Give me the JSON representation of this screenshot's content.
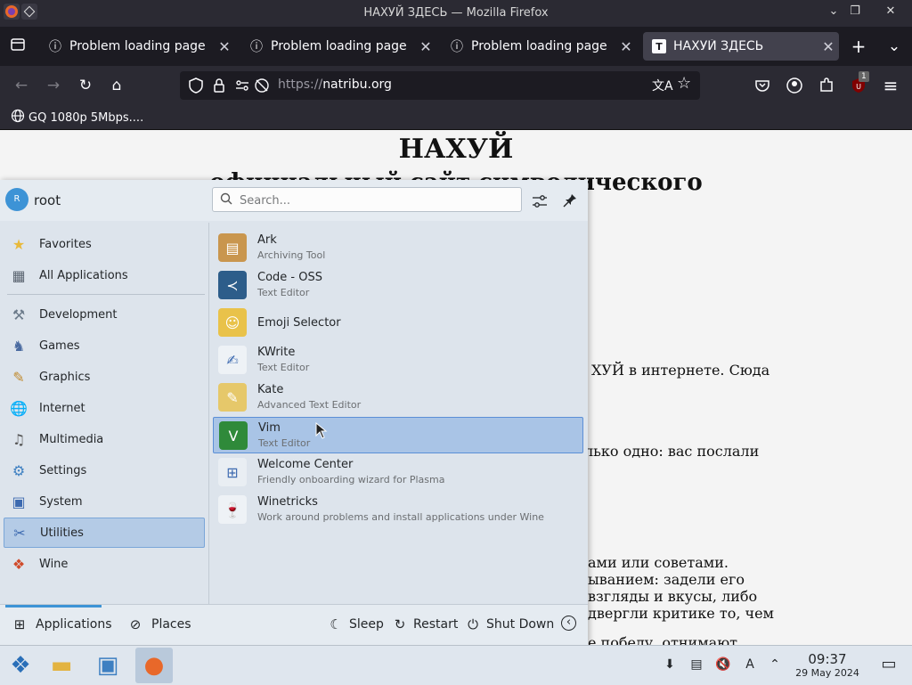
{
  "window": {
    "title": "НАХУЙ ЗДЕСЬ — Mozilla Firefox",
    "controls": {
      "minimize": "⌄",
      "maximize": "⌃",
      "restore": "❐",
      "close": "✕"
    }
  },
  "tabs": [
    {
      "label": "Problem loading page",
      "icon": "info-icon",
      "active": false,
      "close": "✕",
      "glyph": "ⓘ"
    },
    {
      "label": "Problem loading page",
      "icon": "info-icon",
      "active": false,
      "close": "✕",
      "glyph": "ⓘ"
    },
    {
      "label": "Problem loading page",
      "icon": "info-icon",
      "active": false,
      "close": "✕",
      "glyph": "ⓘ"
    },
    {
      "label": "НАХУЙ ЗДЕСЬ",
      "icon": "translate-icon",
      "active": true,
      "close": "✕",
      "glyph": "T"
    }
  ],
  "tabstrip": {
    "new_tab": "+",
    "list_all": "⌄"
  },
  "navbar": {
    "back": "←",
    "forward": "→",
    "reload": "↻",
    "home": "⌂",
    "url_scheme": "https://",
    "url_host": "natribu.org",
    "translate": "文A",
    "bookmark": "☆",
    "pocket": "◡",
    "account": "◉",
    "extensions": "⧉",
    "ublock": "U",
    "ublock_badge": "1",
    "menu": "≡"
  },
  "bookmarks": [
    {
      "label": "GQ 1080p 5Mbps....",
      "icon": "globe-icon"
    }
  ],
  "webpage": {
    "heading": "НАХУЙ",
    "subheading": "официальный сайт символического",
    "fragments": [
      "ХУЙ в интернете. Сюда",
      "лько одно: вас послали",
      "ами или советами.",
      "ыванием:  задели  его",
      "взгляды и вкусы, либо",
      "двергли критике то, чем",
      "е победу, отнимают"
    ]
  },
  "launcher": {
    "user": {
      "initial": "R",
      "name": "root"
    },
    "search_placeholder": "Search...",
    "header_buttons": {
      "configure": "⚙",
      "pin": "📌"
    },
    "categories": [
      {
        "label": "Favorites",
        "icon": "favorites-icon",
        "glyph": "★",
        "color": "#e8b93a",
        "selected": false
      },
      {
        "label": "All Applications",
        "icon": "all-applications-icon",
        "glyph": "▦",
        "color": "#5a6470",
        "selected": false
      },
      {
        "label": "Development",
        "icon": "development-icon",
        "glyph": "⚒",
        "color": "#6b7a8a",
        "selected": false
      },
      {
        "label": "Games",
        "icon": "games-icon",
        "glyph": "♞",
        "color": "#4a6aa0",
        "selected": false
      },
      {
        "label": "Graphics",
        "icon": "graphics-icon",
        "glyph": "✎",
        "color": "#c08a2e",
        "selected": false
      },
      {
        "label": "Internet",
        "icon": "internet-icon",
        "glyph": "🌐",
        "color": "#3d7fc1",
        "selected": false
      },
      {
        "label": "Multimedia",
        "icon": "multimedia-icon",
        "glyph": "♫",
        "color": "#555",
        "selected": false
      },
      {
        "label": "Settings",
        "icon": "settings-icon",
        "glyph": "⚙",
        "color": "#3d7fc1",
        "selected": false
      },
      {
        "label": "System",
        "icon": "system-icon",
        "glyph": "▣",
        "color": "#3d6ab0",
        "selected": false
      },
      {
        "label": "Utilities",
        "icon": "utilities-icon",
        "glyph": "✂",
        "color": "#3d6ab0",
        "selected": true
      },
      {
        "label": "Wine",
        "icon": "wine-icon",
        "glyph": "❖",
        "color": "#d04a2a",
        "selected": false
      }
    ],
    "apps": [
      {
        "name": "Ark",
        "desc": "Archiving Tool",
        "icon": "ark-icon",
        "glyph": "▤",
        "bg": "#c9964e",
        "selected": false
      },
      {
        "name": "Code - OSS",
        "desc": "Text Editor",
        "icon": "code-oss-icon",
        "glyph": "≺",
        "bg": "#2d5d8a",
        "selected": false
      },
      {
        "name": "Emoji Selector",
        "desc": "",
        "icon": "emoji-selector-icon",
        "glyph": "☺",
        "bg": "#e9c24a",
        "selected": false
      },
      {
        "name": "KWrite",
        "desc": "Text Editor",
        "icon": "kwrite-icon",
        "glyph": "✍",
        "bg": "#eef2f6",
        "selected": false
      },
      {
        "name": "Kate",
        "desc": "Advanced Text Editor",
        "icon": "kate-icon",
        "glyph": "✎",
        "bg": "#e6c86a",
        "selected": false
      },
      {
        "name": "Vim",
        "desc": "Text Editor",
        "icon": "vim-icon",
        "glyph": "V",
        "bg": "#2f8a3a",
        "selected": true
      },
      {
        "name": "Welcome Center",
        "desc": "Friendly onboarding wizard for Plasma",
        "icon": "welcome-center-icon",
        "glyph": "⊞",
        "bg": "#e9eef3",
        "selected": false
      },
      {
        "name": "Winetricks",
        "desc": "Work around problems and install applications under Wine",
        "icon": "winetricks-icon",
        "glyph": "🍷",
        "bg": "#eef2f6",
        "selected": false
      }
    ],
    "footer": {
      "tabs": [
        {
          "label": "Applications",
          "icon": "applications-grid-icon",
          "glyph": "⊞",
          "active": true
        },
        {
          "label": "Places",
          "icon": "places-compass-icon",
          "glyph": "⊘",
          "active": false
        }
      ],
      "power": [
        {
          "label": "Sleep",
          "icon": "sleep-icon",
          "glyph": "☾"
        },
        {
          "label": "Restart",
          "icon": "restart-icon",
          "glyph": "↻"
        },
        {
          "label": "Shut Down",
          "icon": "shutdown-icon",
          "glyph": "⏻"
        }
      ],
      "more": "‹"
    }
  },
  "taskbar": {
    "items": [
      {
        "icon": "start-menu-icon",
        "glyph": "❖",
        "color": "#2a6fb8",
        "active": false
      },
      {
        "icon": "file-manager-icon",
        "glyph": "▬",
        "color": "#e3b341",
        "active": false
      },
      {
        "icon": "system-settings-icon",
        "glyph": "▣",
        "color": "#3d7fc1",
        "active": false
      },
      {
        "icon": "firefox-icon",
        "glyph": "●",
        "color": "#e8682a",
        "active": true
      }
    ],
    "tray": [
      {
        "icon": "updates-icon",
        "glyph": "⬇"
      },
      {
        "icon": "clipboard-icon",
        "glyph": "▤"
      },
      {
        "icon": "volume-muted-icon",
        "glyph": "🔇"
      },
      {
        "icon": "keyboard-layout-icon",
        "glyph": "A"
      },
      {
        "icon": "tray-expand-icon",
        "glyph": "⌃"
      }
    ],
    "clock": {
      "time": "09:37",
      "date": "29 May 2024"
    },
    "show_desktop": "▭"
  }
}
